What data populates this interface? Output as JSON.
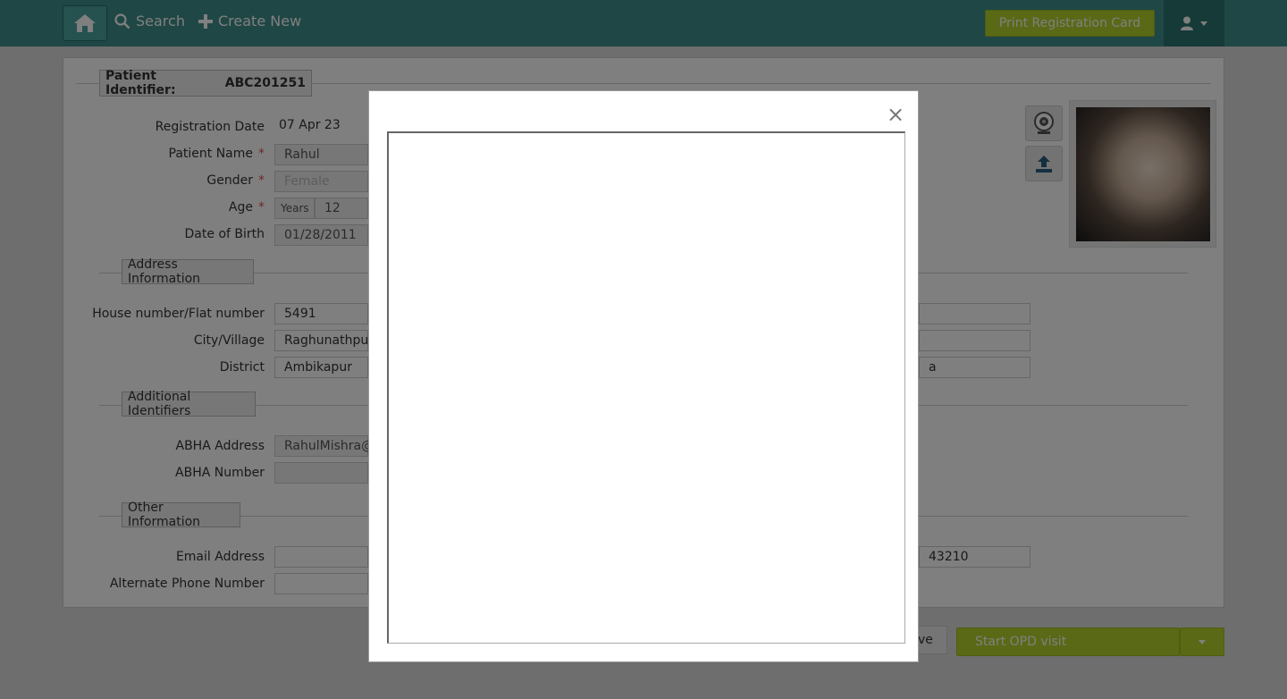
{
  "nav": {
    "search_label": "Search",
    "create_new_label": "Create New",
    "print_card_label": "Print Registration Card"
  },
  "header": {
    "patient_identifier_label": "Patient Identifier:",
    "patient_identifier_value": "ABC201251"
  },
  "basic": {
    "registration_date_label": "Registration Date",
    "registration_date_value": "07 Apr 23",
    "patient_name_label": "Patient Name",
    "patient_name_value": "Rahul",
    "gender_label": "Gender",
    "gender_value": "Female",
    "age_label": "Age",
    "age_unit": "Years",
    "age_value": "12",
    "dob_label": "Date of Birth",
    "dob_value": "01/28/2011",
    "required_mark": "*"
  },
  "address": {
    "section_label": "Address Information",
    "house_label": "House number/Flat number",
    "house_value": "5491",
    "city_label": "City/Village",
    "city_value": "Raghunathpur",
    "district_label": "District",
    "district_value": "Ambikapur",
    "right_col_partial": "a"
  },
  "identifiers": {
    "section_label": "Additional Identifiers",
    "abha_address_label": "ABHA Address",
    "abha_address_value": "RahulMishra@",
    "abha_number_label": "ABHA Number",
    "abha_number_value": ""
  },
  "other": {
    "section_label": "Other Information",
    "email_label": "Email Address",
    "email_value": "",
    "alt_phone_label": "Alternate Phone Number",
    "alt_phone_value": "",
    "phone_partial": "43210"
  },
  "footer": {
    "save_partial": "ve",
    "start_opd_label": "Start OPD visit"
  },
  "modal": {
    "close_glyph": "×"
  }
}
